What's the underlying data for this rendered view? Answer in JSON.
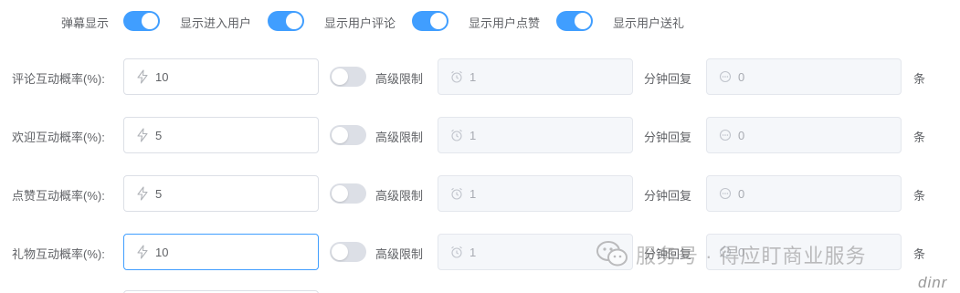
{
  "toggles": [
    {
      "label": "弹幕显示",
      "on": true
    },
    {
      "label": "显示进入用户",
      "on": true
    },
    {
      "label": "显示用户评论",
      "on": true
    },
    {
      "label": "显示用户点赞",
      "on": true
    },
    {
      "label": "显示用户送礼",
      "on": false
    }
  ],
  "common": {
    "advanced_limit_label": "高级限制",
    "minutes_reply_label": "分钟回复",
    "unit_label": "条"
  },
  "rows": [
    {
      "label": "评论互动概率(%):",
      "probability": "10",
      "advanced_limit_on": false,
      "limit_value": "1",
      "reply_value": "0"
    },
    {
      "label": "欢迎互动概率(%):",
      "probability": "5",
      "advanced_limit_on": false,
      "limit_value": "1",
      "reply_value": "0"
    },
    {
      "label": "点赞互动概率(%):",
      "probability": "5",
      "advanced_limit_on": false,
      "limit_value": "1",
      "reply_value": "0"
    },
    {
      "label": "礼物互动概率(%):",
      "probability": "10",
      "advanced_limit_on": false,
      "limit_value": "1",
      "reply_value": "0"
    }
  ],
  "watermark": {
    "text": "服务号 · 得应盯商业服务",
    "mark": "dinr"
  },
  "colors": {
    "accent": "#409eff",
    "switch_off": "#dcdfe6",
    "disabled_bg": "#f5f7fa"
  }
}
